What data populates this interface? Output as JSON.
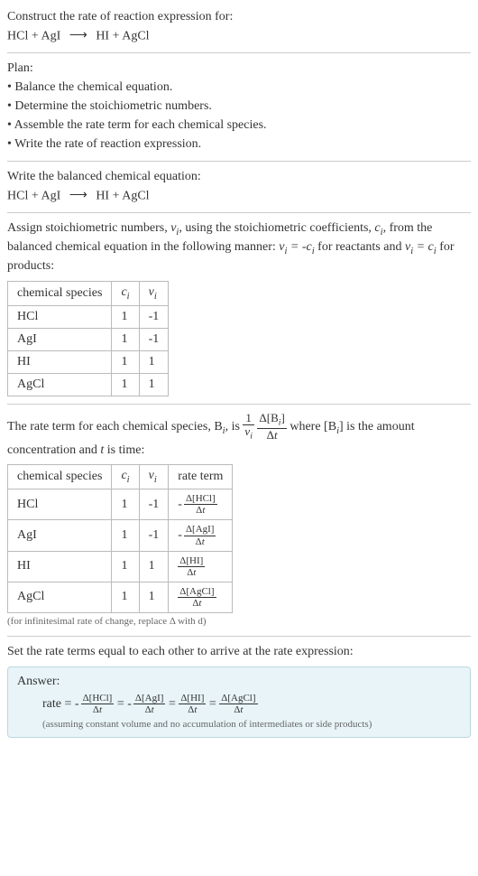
{
  "prompt": "Construct the rate of reaction expression for:",
  "reaction": {
    "reactants": "HCl + AgI",
    "products": "HI + AgCl"
  },
  "plan": {
    "heading": "Plan:",
    "items": [
      "Balance the chemical equation.",
      "Determine the stoichiometric numbers.",
      "Assemble the rate term for each chemical species.",
      "Write the rate of reaction expression."
    ]
  },
  "balanced_intro": "Write the balanced chemical equation:",
  "stoich_intro_1": "Assign stoichiometric numbers, ",
  "stoich_intro_2": ", using the stoichiometric coefficients, ",
  "stoich_intro_3": ", from the balanced chemical equation in the following manner: ",
  "stoich_intro_4": " for reactants and ",
  "stoich_intro_5": " for products:",
  "table1": {
    "headers": [
      "chemical species",
      "c_i",
      "ν_i"
    ],
    "rows": [
      [
        "HCl",
        "1",
        "-1"
      ],
      [
        "AgI",
        "1",
        "-1"
      ],
      [
        "HI",
        "1",
        "1"
      ],
      [
        "AgCl",
        "1",
        "1"
      ]
    ]
  },
  "rate_intro_1": "The rate term for each chemical species, B",
  "rate_intro_2": ", is ",
  "rate_intro_3": " where [B",
  "rate_intro_4": "] is the amount concentration and ",
  "rate_intro_5": " is time:",
  "table2": {
    "headers": [
      "chemical species",
      "c_i",
      "ν_i",
      "rate term"
    ],
    "rows": [
      {
        "species": "HCl",
        "c": "1",
        "v": "-1",
        "neg": true,
        "B": "HCl"
      },
      {
        "species": "AgI",
        "c": "1",
        "v": "-1",
        "neg": true,
        "B": "AgI"
      },
      {
        "species": "HI",
        "c": "1",
        "v": "1",
        "neg": false,
        "B": "HI"
      },
      {
        "species": "AgCl",
        "c": "1",
        "v": "1",
        "neg": false,
        "B": "AgCl"
      }
    ]
  },
  "footnote": "(for infinitesimal rate of change, replace Δ with d)",
  "set_equal": "Set the rate terms equal to each other to arrive at the rate expression:",
  "answer": {
    "label": "Answer:",
    "rate_label": "rate",
    "terms": [
      {
        "neg": true,
        "B": "HCl"
      },
      {
        "neg": true,
        "B": "AgI"
      },
      {
        "neg": false,
        "B": "HI"
      },
      {
        "neg": false,
        "B": "AgCl"
      }
    ],
    "assumption": "(assuming constant volume and no accumulation of intermediates or side products)"
  }
}
